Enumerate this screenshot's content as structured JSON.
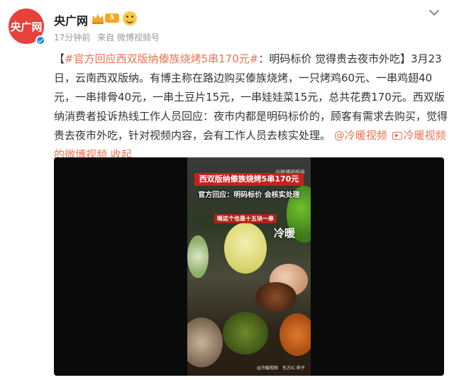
{
  "post": {
    "author": "央广网",
    "avatar_text": "央广网",
    "level": "5",
    "time": "17分钟前",
    "source": "来自 微博视频号",
    "text": {
      "bracket_open": "【",
      "hashtag": "#官方回应西双版纳傣族烧烤5串170元#",
      "body": "：明码标价 觉得贵去夜市外吃】3月23日，云南西双版纳。有博主称在路边购买傣族烧烤，一只烤鸡60元、一串鸡翅40元，一串排骨40元，一串土豆片15元，一串娃娃菜15元，总共花费170元。西双版纳消费者投诉热线工作人员回应：夜市内都是明码标价的，顾客有需求去购买，觉得贵去夜市外吃，针对视频内容，会有工作人员去核实处理。",
      "mention": "@冷暖视频",
      "video_link": "冷暖视频的微博视频",
      "collapse": "收起"
    }
  },
  "video": {
    "caption_title": "西双版纳傣族烧烤5串170元",
    "caption_response": "官方回应：明码标价 会核实处理",
    "caption_subtitle": "嗯这个也是十五块一串",
    "watermark_name": "冷暖",
    "watermark_top": "@微博视频号",
    "watermark_bottom_left": "@冷暖视频",
    "watermark_bottom_right": "东方IC 样子"
  },
  "colors": {
    "link": "#eb7350",
    "caption_red": "#c8201e",
    "avatar_red": "#e8403a"
  },
  "icons": [
    "verified-icon",
    "crown-badge-icon",
    "emoji-badge-icon",
    "chevron-down-icon",
    "video-link-icon"
  ]
}
